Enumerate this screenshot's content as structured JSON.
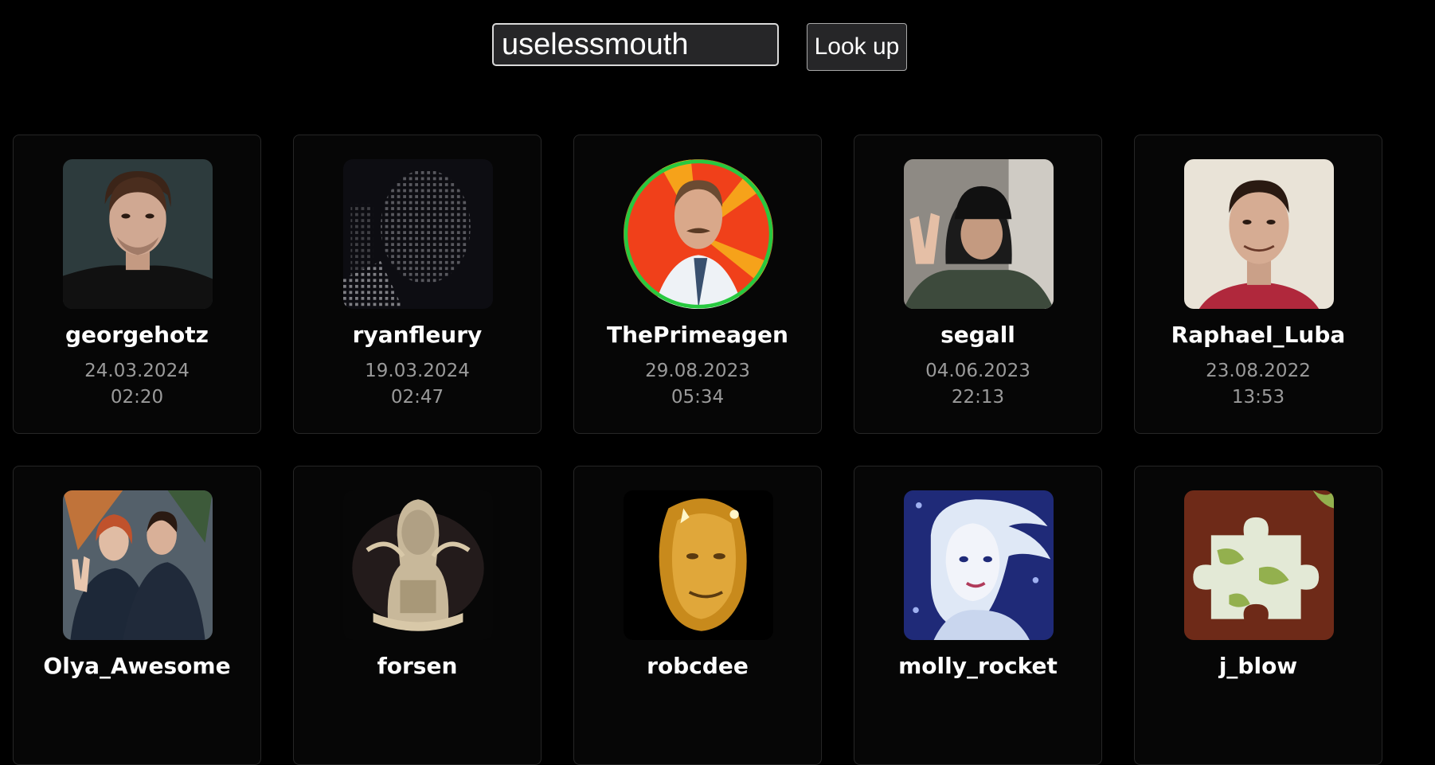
{
  "search": {
    "value": "uselessmouth",
    "button_label": "Look up"
  },
  "users": [
    {
      "name": "georgehotz",
      "date": "24.03.2024",
      "time": "02:20",
      "avatar": "portrait-dark"
    },
    {
      "name": "ryanfleury",
      "date": "19.03.2024",
      "time": "02:47",
      "avatar": "ascii-portrait"
    },
    {
      "name": "ThePrimeagen",
      "date": "29.08.2023",
      "time": "05:34",
      "avatar": "portrait-sunburst"
    },
    {
      "name": "segall",
      "date": "04.06.2023",
      "time": "22:13",
      "avatar": "selfie-hood"
    },
    {
      "name": "Raphael_Luba",
      "date": "23.08.2022",
      "time": "13:53",
      "avatar": "portrait-light"
    },
    {
      "name": "Olya_Awesome",
      "date": "",
      "time": "",
      "avatar": "couple-photo"
    },
    {
      "name": "forsen",
      "date": "",
      "time": "",
      "avatar": "emblem-sketch"
    },
    {
      "name": "robcdee",
      "date": "",
      "time": "",
      "avatar": "golden-face"
    },
    {
      "name": "molly_rocket",
      "date": "",
      "time": "",
      "avatar": "illustrated-girl"
    },
    {
      "name": "j_blow",
      "date": "",
      "time": "",
      "avatar": "puzzle-piece"
    }
  ]
}
